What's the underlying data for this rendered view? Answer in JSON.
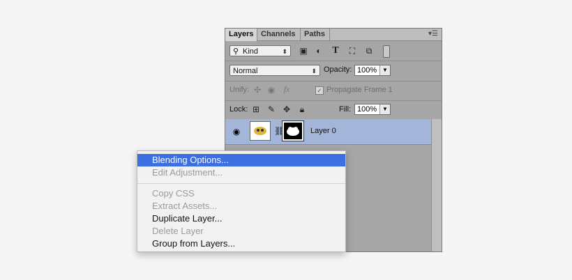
{
  "tabs": [
    "Layers",
    "Channels",
    "Paths"
  ],
  "panel_menu_icon": "panel-menu-icon",
  "filter": {
    "label": "Kind"
  },
  "blend": {
    "mode": "Normal",
    "opacity_label": "Opacity:",
    "opacity_value": "100%"
  },
  "unify": {
    "label": "Unify:",
    "propagate_label": "Propagate Frame 1"
  },
  "lock": {
    "label": "Lock:",
    "fill_label": "Fill:",
    "fill_value": "100%"
  },
  "layer": {
    "name": "Layer 0"
  },
  "context_menu": {
    "items": [
      {
        "label": "Blending Options...",
        "state": "highlighted"
      },
      {
        "label": "Edit Adjustment...",
        "state": "disabled"
      },
      {
        "label": "Copy CSS",
        "state": "disabled"
      },
      {
        "label": "Extract Assets...",
        "state": "disabled"
      },
      {
        "label": "Duplicate Layer...",
        "state": "enabled"
      },
      {
        "label": "Delete Layer",
        "state": "disabled"
      },
      {
        "label": "Group from Layers...",
        "state": "enabled"
      }
    ]
  },
  "colors": {
    "highlight": "#3d6fe0",
    "selected_layer": "#a3b5d9",
    "panel": "#a6a6a6"
  }
}
